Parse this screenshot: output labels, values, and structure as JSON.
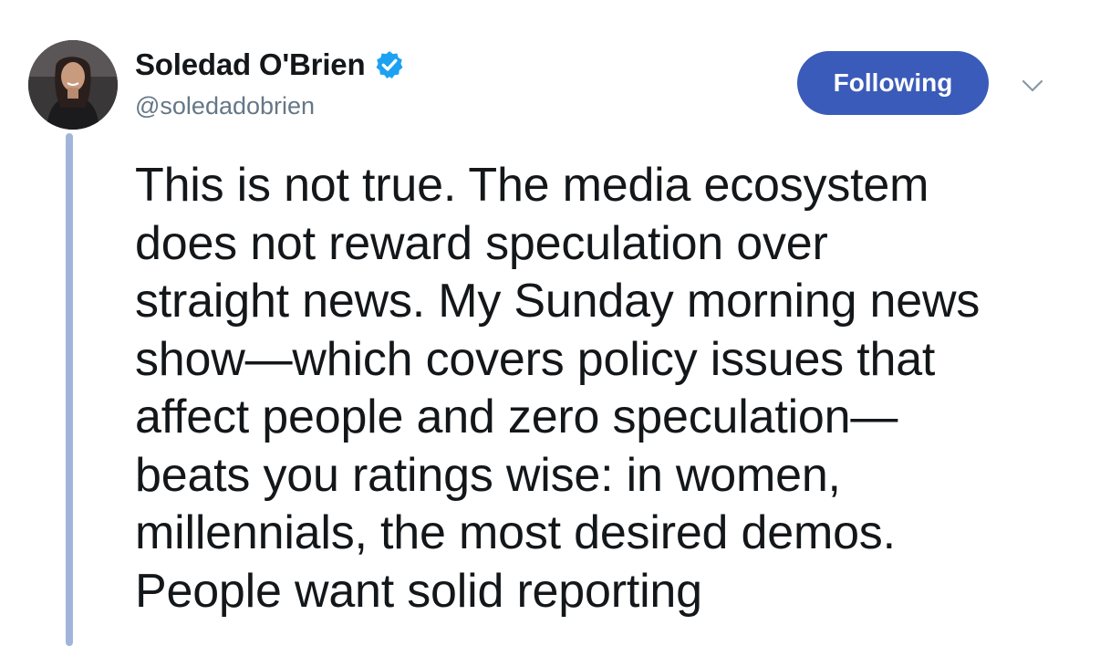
{
  "author": {
    "display_name": "Soledad O'Brien",
    "handle": "@soledadobrien",
    "verified": true,
    "avatar_icon": "profile-photo"
  },
  "actions": {
    "follow_label": "Following",
    "menu_icon": "chevron-down-icon"
  },
  "tweet": {
    "lines": [
      "This is not true. The media ecosystem",
      "does not reward speculation over",
      "straight news. My Sunday morning news",
      "show—which covers policy issues that",
      "affect people and zero speculation—",
      "beats you ratings wise: in women,",
      "millennials, the most desired demos.",
      "People want solid reporting"
    ]
  },
  "colors": {
    "follow_button": "#3a5bb9",
    "verified_badge": "#1da1f2",
    "handle_text": "#657786",
    "thread_line": "#a3b4da"
  }
}
